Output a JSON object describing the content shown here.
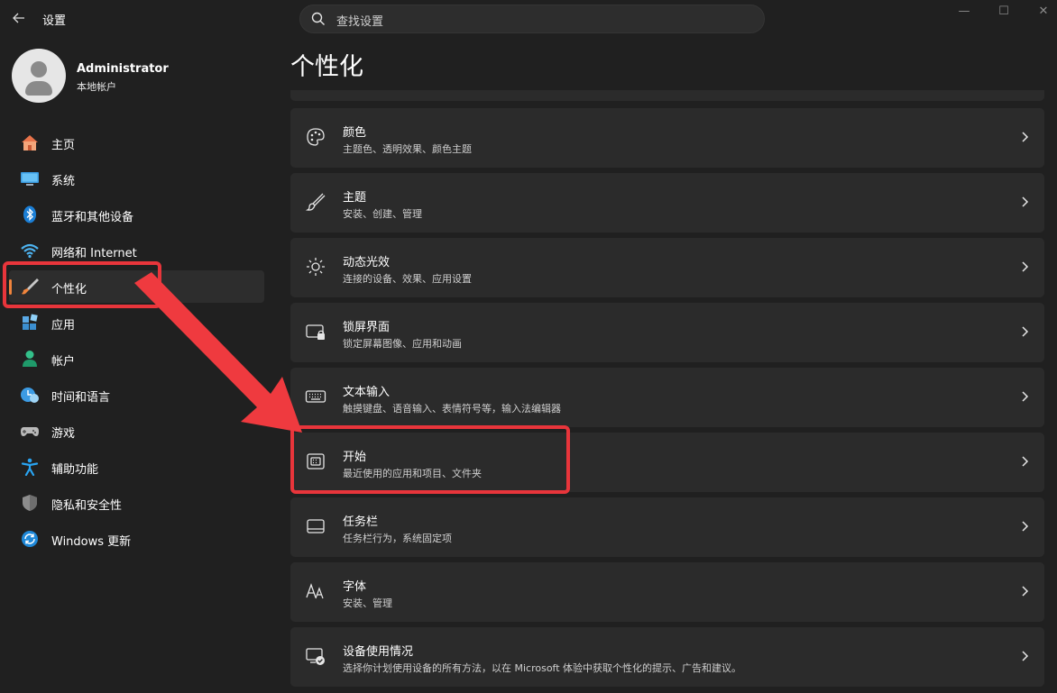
{
  "window": {
    "title": "设置",
    "controls": {
      "minimize": "—",
      "maximize": "☐",
      "close": "✕"
    }
  },
  "search": {
    "placeholder": "查找设置"
  },
  "user": {
    "name": "Administrator",
    "account_type": "本地帐户"
  },
  "sidebar": {
    "items": [
      {
        "label": "主页",
        "icon": "home-icon"
      },
      {
        "label": "系统",
        "icon": "system-icon"
      },
      {
        "label": "蓝牙和其他设备",
        "icon": "bluetooth-icon"
      },
      {
        "label": "网络和 Internet",
        "icon": "wifi-icon"
      },
      {
        "label": "个性化",
        "icon": "brush-icon",
        "selected": true
      },
      {
        "label": "应用",
        "icon": "apps-icon"
      },
      {
        "label": "帐户",
        "icon": "account-icon"
      },
      {
        "label": "时间和语言",
        "icon": "time-language-icon"
      },
      {
        "label": "游戏",
        "icon": "gamepad-icon"
      },
      {
        "label": "辅助功能",
        "icon": "accessibility-icon"
      },
      {
        "label": "隐私和安全性",
        "icon": "shield-icon"
      },
      {
        "label": "Windows 更新",
        "icon": "update-icon"
      }
    ]
  },
  "main": {
    "title": "个性化",
    "cards": [
      {
        "title": "颜色",
        "subtitle": "主题色、透明效果、颜色主题",
        "icon": "palette-icon"
      },
      {
        "title": "主题",
        "subtitle": "安装、创建、管理",
        "icon": "brush-icon"
      },
      {
        "title": "动态光效",
        "subtitle": "连接的设备、效果、应用设置",
        "icon": "lighting-icon"
      },
      {
        "title": "锁屏界面",
        "subtitle": "锁定屏幕图像、应用和动画",
        "icon": "lock-screen-icon"
      },
      {
        "title": "文本输入",
        "subtitle": "触摸键盘、语音输入、表情符号等，输入法编辑器",
        "icon": "keyboard-icon"
      },
      {
        "title": "开始",
        "subtitle": "最近使用的应用和项目、文件夹",
        "icon": "start-icon"
      },
      {
        "title": "任务栏",
        "subtitle": "任务栏行为，系统固定项",
        "icon": "taskbar-icon"
      },
      {
        "title": "字体",
        "subtitle": "安装、管理",
        "icon": "font-icon"
      },
      {
        "title": "设备使用情况",
        "subtitle": "选择你计划使用设备的所有方法，以在 Microsoft 体验中获取个性化的提示、广告和建议。",
        "icon": "device-usage-icon"
      }
    ]
  },
  "colors": {
    "background": "#202020",
    "card": "#2b2b2b",
    "accent": "#f0843c",
    "annotation": "#e8353b"
  }
}
